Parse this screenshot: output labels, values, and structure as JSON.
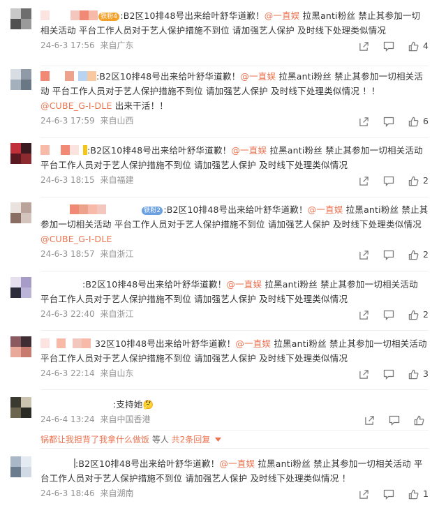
{
  "comments": [
    {
      "avatar": [
        "#c8c8c8",
        "#6e6e6e",
        "#505050",
        "#9a9a9a"
      ],
      "badge": "铁粉4",
      "badge_color": "orange",
      "text_pre": ":B2区10排48号出来给叶舒华道歉！",
      "mention1": "@一直娱",
      "text_post": " 拉黑anti粉丝 禁止其参加一切相关活动 平台工作人员对于艺人保护措施不到位 请加强艺人保护 及时线下处理类似情况",
      "mention2": "",
      "tail": "",
      "date": "24-6-3 17:56",
      "location": "来自广东",
      "likes": "4"
    },
    {
      "avatar": [
        "#d8dde4",
        "#8f9aa6",
        "#a4b0bc",
        "#6a7785"
      ],
      "badge": "",
      "badge_color": "",
      "text_pre": ":B2区10排48号出来给叶舒华道歉！",
      "mention1": "@一直娱",
      "text_post": " 拉黑anti粉丝 禁止其参加一切相关活动 平台工作人员对于艺人保护措施不到位 请加强艺人保护 及时线下处理类似情况 ！！",
      "mention2": "@CUBE_G-I-DLE",
      "tail": " 出来干活！！",
      "date": "24-6-3 17:59",
      "location": "来自山西",
      "likes": "6"
    },
    {
      "avatar": [
        "#c0303a",
        "#3a1a1e",
        "#5a1820",
        "#8c2a30"
      ],
      "badge": "",
      "badge_color": "",
      "text_pre": ":B2区10排48号出来给叶舒华道歉！",
      "mention1": "@一直娱",
      "text_post": " 拉黑anti粉丝 禁止其参加一切相关活动 平台工作人员对于艺人保护措施不到位 请加强艺人保护 及时线下处理类似情况",
      "mention2": "",
      "tail": "",
      "date": "24-6-3 18:15",
      "location": "来自福建",
      "likes": "2"
    },
    {
      "avatar": [
        "#e9e2de",
        "#b9a39a",
        "#8a6e64",
        "#d3c4bd"
      ],
      "badge": "铁粉2",
      "badge_color": "blue",
      "text_pre": ":B2区10排48号出来给叶舒华道歉！",
      "mention1": "@一直娱",
      "text_post": " 拉黑anti粉丝 禁止其参加一切相关活动 平台工作人员对于艺人保护措施不到位 请加强艺人保护 及时线下处理类似情况 ",
      "mention2": "@CUBE_G-I-DLE",
      "tail": "",
      "date": "24-6-3 18:57",
      "location": "来自浙江",
      "likes": "2"
    },
    {
      "avatar": [
        "#e4e0ee",
        "#a79bc7",
        "#2c2c3a",
        "#bcb3d8"
      ],
      "badge": "",
      "badge_color": "",
      "text_pre": ":B2区10排48号出来给叶舒华道歉！",
      "mention1": "@一直娱",
      "text_post": " 拉黑anti粉丝 禁止其参加一切相关活动 平台工作人员对于艺人保护措施不到位 请加强艺人保护 及时线下处理类似情况",
      "mention2": "",
      "tail": "",
      "date": "24-6-3 22:40",
      "location": "来自浙江",
      "likes": "2"
    },
    {
      "avatar": [
        "#8a5a60",
        "#3e2e34",
        "#e8a89a",
        "#c97a6e"
      ],
      "badge": "",
      "badge_color": "",
      "text_pre": "32区10排48号出来给叶舒华道歉！",
      "mention1": "@一直娱",
      "text_post": " 拉黑anti粉丝 禁止其参加一切相关活动 平台工作人员对于艺人保护措施不到位 请加强艺人保护 及时线下处理类似情况",
      "mention2": "",
      "tail": "",
      "date": "24-6-3 22:14",
      "location": "来自山东",
      "likes": "3"
    },
    {
      "avatar": [
        "#3a3a30",
        "#c9c3b0",
        "#6b6550",
        "#2a2a24"
      ],
      "badge": "",
      "badge_color": "",
      "text_pre": ":支持她🤔",
      "mention1": "",
      "text_post": "",
      "mention2": "",
      "tail": "",
      "date": "24-6-4 13:24",
      "location": "来自中国香港",
      "likes": ""
    },
    {
      "avatar": [
        "#a9b7c7",
        "#e5ebf2",
        "#6b7c8f",
        "#d1dae4"
      ],
      "badge": "",
      "badge_color": "",
      "text_pre": ":B2区10排48号出来给叶舒华道歉！",
      "mention1": "@一直娱",
      "text_post": " 拉黑anti粉丝 禁止其参加一切相关活动 平台工作人员对于艺人保护措施不到位 请加强艺人保护 及时线下处理类似情况 ！",
      "mention2": "",
      "tail": "",
      "date": "24-6-3 18:46",
      "location": "来自湖南",
      "likes": "1"
    }
  ],
  "reply_summary": {
    "who": "锅都让我担背了我拿什么做饭",
    "deng": " 等人 ",
    "total": "共2条回复"
  },
  "icons": {
    "share": "share-icon",
    "comment": "comment-icon",
    "like": "thumbs-up-icon",
    "expand": "chevron-down-icon"
  },
  "colors": {
    "mention": "#eb7350",
    "meta": "#939393",
    "text": "#333333"
  }
}
